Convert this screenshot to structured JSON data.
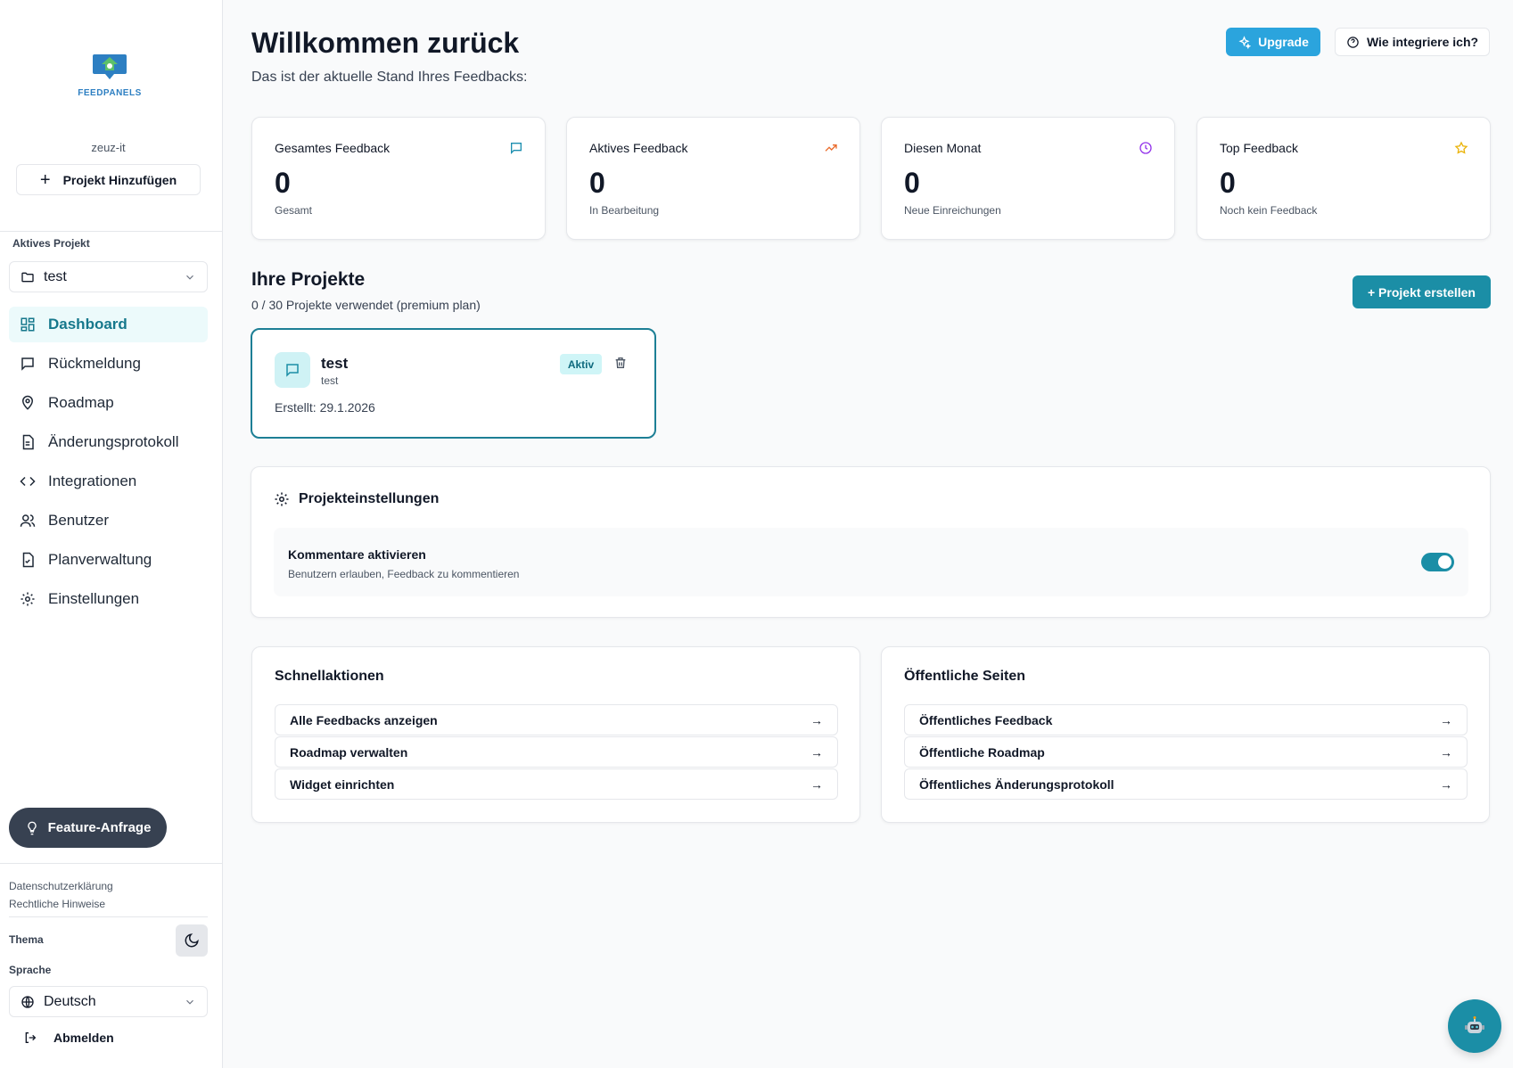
{
  "app": {
    "brand": "FEEDPANELS",
    "workspace": "zeuz-it",
    "add_project": "Projekt Hinzufügen"
  },
  "sidebar": {
    "active_project_label": "Aktives Projekt",
    "active_project": "test",
    "nav": [
      {
        "label": "Dashboard",
        "icon": "dashboard-icon",
        "active": true
      },
      {
        "label": "Rückmeldung",
        "icon": "message-icon",
        "active": false
      },
      {
        "label": "Roadmap",
        "icon": "map-pin-icon",
        "active": false
      },
      {
        "label": "Änderungsprotokoll",
        "icon": "document-icon",
        "active": false
      },
      {
        "label": "Integrationen",
        "icon": "code-icon",
        "active": false
      },
      {
        "label": "Benutzer",
        "icon": "users-icon",
        "active": false
      },
      {
        "label": "Planverwaltung",
        "icon": "plan-icon",
        "active": false
      },
      {
        "label": "Einstellungen",
        "icon": "gear-icon",
        "active": false
      }
    ],
    "feature_request": "Feature-Anfrage",
    "privacy": "Datenschutzerklärung",
    "legal": "Rechtliche Hinweise",
    "theme_label": "Thema",
    "language_label": "Sprache",
    "language": "Deutsch",
    "logout": "Abmelden"
  },
  "header": {
    "title": "Willkommen zurück",
    "subtitle": "Das ist der aktuelle Stand Ihres Feedbacks:",
    "upgrade": "Upgrade",
    "integrate": "Wie integriere ich?"
  },
  "stats": [
    {
      "title": "Gesamtes Feedback",
      "value": "0",
      "caption": "Gesamt",
      "icon": "message-icon",
      "color": "#1d8fb0"
    },
    {
      "title": "Aktives Feedback",
      "value": "0",
      "caption": "In Bearbeitung",
      "icon": "trending-up-icon",
      "color": "#ea6a2b"
    },
    {
      "title": "Diesen Monat",
      "value": "0",
      "caption": "Neue Einreichungen",
      "icon": "clock-icon",
      "color": "#9333ea"
    },
    {
      "title": "Top Feedback",
      "value": "0",
      "caption": "Noch kein Feedback",
      "icon": "star-icon",
      "color": "#eab308"
    }
  ],
  "projects": {
    "title": "Ihre Projekte",
    "usage": "0 / 30 Projekte verwendet (premium plan)",
    "create": "+ Projekt erstellen",
    "items": [
      {
        "name": "test",
        "sub": "test",
        "badge": "Aktiv",
        "created": "Erstellt: 29.1.2026"
      }
    ]
  },
  "settings": {
    "title": "Projekteinstellungen",
    "comments_title": "Kommentare aktivieren",
    "comments_desc": "Benutzern erlauben, Feedback zu kommentieren",
    "comments_enabled": true
  },
  "quick_actions": {
    "title": "Schnellaktionen",
    "items": [
      "Alle Feedbacks anzeigen",
      "Roadmap verwalten",
      "Widget einrichten"
    ]
  },
  "public_pages": {
    "title": "Öffentliche Seiten",
    "items": [
      "Öffentliches Feedback",
      "Öffentliche Roadmap",
      "Öffentliches Änderungsprotokoll"
    ]
  },
  "colors": {
    "accent": "#1b8ea6",
    "upgrade": "#2ba4dd",
    "sidebar_active_bg": "#ecfafb"
  }
}
